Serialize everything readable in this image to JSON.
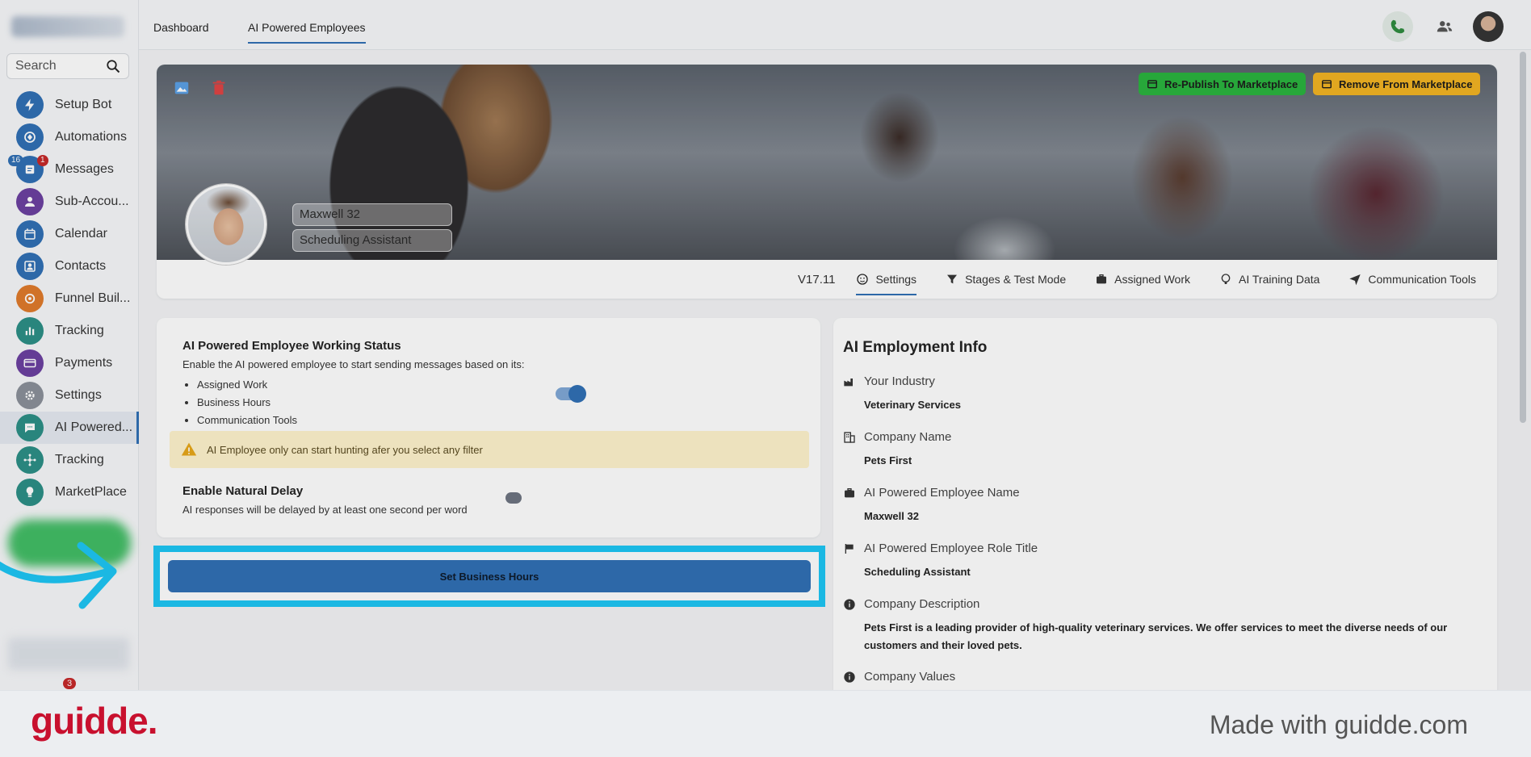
{
  "sidebar": {
    "search_placeholder": "Search",
    "items": [
      {
        "label": "Setup Bot",
        "icon": "lightning-icon",
        "color": "#2f6fb5"
      },
      {
        "label": "Automations",
        "icon": "automation-icon",
        "color": "#2f6fb5"
      },
      {
        "label": "Messages",
        "icon": "messages-icon",
        "color": "#2f6fb5",
        "badge_blue": "16",
        "badge_red": "1"
      },
      {
        "label": "Sub-Accou...",
        "icon": "user-icon",
        "color": "#6b3fa0"
      },
      {
        "label": "Calendar",
        "icon": "calendar-icon",
        "color": "#2f6fb5"
      },
      {
        "label": "Contacts",
        "icon": "contacts-icon",
        "color": "#2f6fb5"
      },
      {
        "label": "Funnel Buil...",
        "icon": "funnel-icon",
        "color": "#e07a2a"
      },
      {
        "label": "Tracking",
        "icon": "bar-chart-icon",
        "color": "#2b8f86"
      },
      {
        "label": "Payments",
        "icon": "card-icon",
        "color": "#6b3fa0"
      },
      {
        "label": "Settings",
        "icon": "gear-icon",
        "color": "#8a9099"
      },
      {
        "label": "AI Powered...",
        "icon": "chat-icon",
        "color": "#2b8f86",
        "active": true
      },
      {
        "label": "Tracking",
        "icon": "network-icon",
        "color": "#2b8f86"
      },
      {
        "label": "MarketPlace",
        "icon": "bulb-icon",
        "color": "#2b8f86"
      }
    ],
    "bottom_badge": "3"
  },
  "topbar": {
    "tabs": [
      {
        "label": "Dashboard"
      },
      {
        "label": "AI Powered Employees",
        "selected": true
      }
    ]
  },
  "banner": {
    "republish_label": "Re-Publish To Marketplace",
    "remove_label": "Remove From Marketplace",
    "republish_color": "#29b33d",
    "remove_color": "#f2b321",
    "employee_name": "Maxwell 32",
    "employee_role": "Scheduling Assistant",
    "version": "V17.11",
    "tabs": [
      {
        "label": "Settings",
        "icon": "face-icon",
        "selected": true
      },
      {
        "label": "Stages & Test Mode",
        "icon": "filter-icon"
      },
      {
        "label": "Assigned Work",
        "icon": "briefcase-icon"
      },
      {
        "label": "AI Training Data",
        "icon": "brain-icon"
      },
      {
        "label": "Communication Tools",
        "icon": "send-icon"
      }
    ]
  },
  "status": {
    "title": "AI Powered Employee Working Status",
    "description": "Enable the AI powered employee to start sending messages based on its:",
    "bullets": [
      "Assigned Work",
      "Business Hours",
      "Communication Tools"
    ],
    "enabled": true,
    "warning": "AI Employee only can start hunting afer you select any filter"
  },
  "delay": {
    "title": "Enable Natural Delay",
    "description": "AI responses will be delayed by at least one second per word",
    "enabled": false
  },
  "business_hours_button": "Set Business Hours",
  "employment_info": {
    "title": "AI Employment Info",
    "rows": [
      {
        "label": "Your Industry",
        "icon": "factory-icon",
        "value": "Veterinary Services"
      },
      {
        "label": "Company Name",
        "icon": "building-icon",
        "value": "Pets First"
      },
      {
        "label": "AI Powered Employee Name",
        "icon": "briefcase-icon",
        "value": "Maxwell 32"
      },
      {
        "label": "AI Powered Employee Role Title",
        "icon": "flag-icon",
        "value": "Scheduling Assistant"
      },
      {
        "label": "Company Description",
        "icon": "info-icon",
        "value": "Pets First is a leading provider of high-quality veterinary services. We offer services to meet the diverse needs of our customers and their loved pets."
      },
      {
        "label": "Company Values",
        "icon": "info-icon",
        "value": ""
      }
    ]
  },
  "footer": {
    "brand": "guidde.",
    "made_with": "Made with guidde.com"
  },
  "colors": {
    "accent": "#2f6fb5",
    "highlight": "#1cc6f5",
    "brand": "#c8102e"
  }
}
